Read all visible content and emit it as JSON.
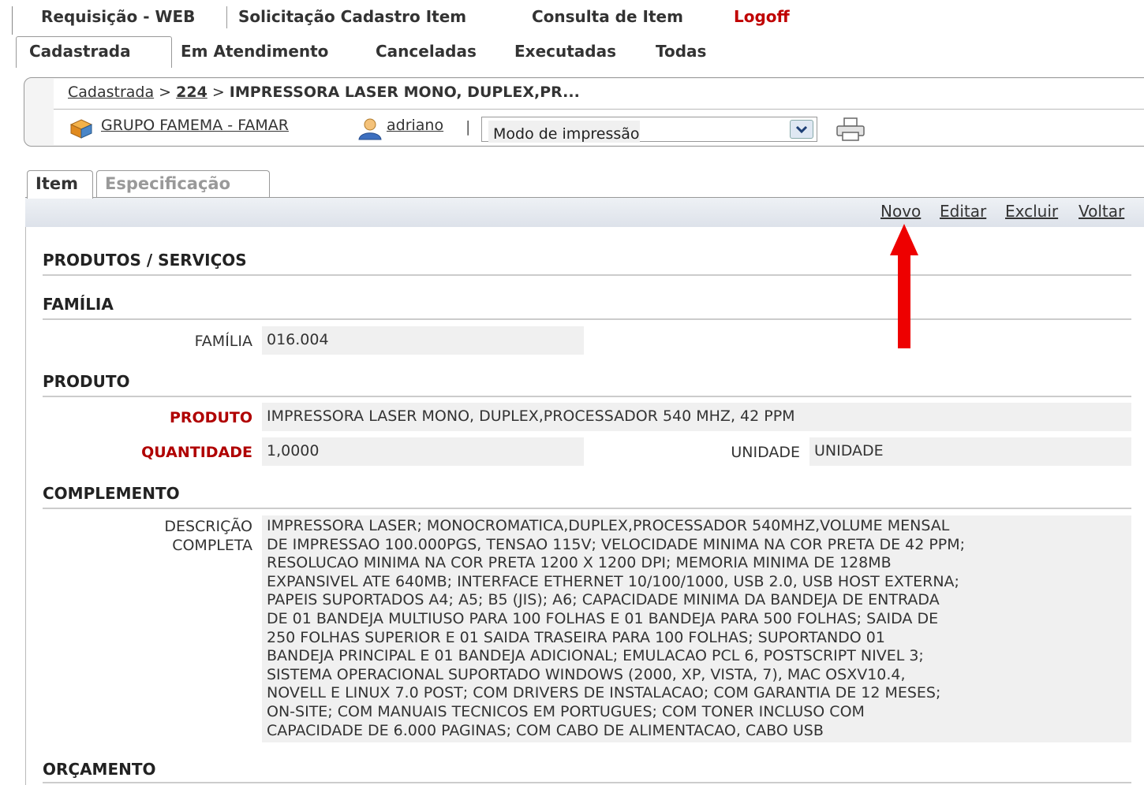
{
  "topnav": {
    "active_tab": "Requisição - WEB",
    "links": [
      "Solicitação Cadastro Item",
      "Consulta de Item",
      "Logoff"
    ]
  },
  "subnav": {
    "active_tab": "Cadastrada",
    "links": [
      "Em Atendimento",
      "Canceladas",
      "Executadas",
      "Todas"
    ]
  },
  "breadcrumb": {
    "link": "Cadastrada",
    "sep1": " > ",
    "number": "224",
    "sep2": " > ",
    "title": "IMPRESSORA LASER MONO, DUPLEX,PR..."
  },
  "infobar": {
    "group_icon": "box-icon",
    "group": "GRUPO FAMEMA - FAMAR",
    "user_icon": "user-icon",
    "user": "adriano",
    "pipe": "|",
    "print_mode": "Modo de impressão",
    "printer_icon": "printer-icon"
  },
  "tabs": {
    "item": "Item",
    "spec": "Especificação"
  },
  "actions": {
    "novo": "Novo",
    "editar": "Editar",
    "excluir": "Excluir",
    "voltar": "Voltar"
  },
  "sections": {
    "produtos": "PRODUTOS / SERVIÇOS",
    "familia": "FAMÍLIA",
    "produto": "PRODUTO",
    "complemento": "COMPLEMENTO",
    "orcamento": "ORÇAMENTO"
  },
  "fields": {
    "familia_label": "FAMÍLIA",
    "familia_value": "016.004",
    "produto_label": "PRODUTO",
    "produto_value": "IMPRESSORA LASER MONO, DUPLEX,PROCESSADOR 540 MHZ, 42 PPM",
    "quantidade_label": "QUANTIDADE",
    "quantidade_value": "1,0000",
    "unidade_label": "UNIDADE",
    "unidade_value": "UNIDADE",
    "descricao_label_1": "DESCRIÇÃO",
    "descricao_label_2": "COMPLETA",
    "descricao_lines": [
      "IMPRESSORA LASER; MONOCROMATICA,DUPLEX,PROCESSADOR 540MHZ,VOLUME MENSAL",
      "DE IMPRESSAO 100.000PGS, TENSAO 115V; VELOCIDADE MINIMA NA COR PRETA DE 42 PPM;",
      "RESOLUCAO MINIMA NA COR PRETA 1200 X 1200 DPI; MEMORIA MINIMA DE 128MB",
      "EXPANSIVEL ATE 640MB; INTERFACE ETHERNET 10/100/1000, USB 2.0, USB HOST EXTERNA;",
      "PAPEIS SUPORTADOS A4; A5; B5 (JIS); A6; CAPACIDADE MINIMA DA BANDEJA DE ENTRADA",
      "DE 01 BANDEJA MULTIUSO PARA 100 FOLHAS E 01 BANDEJA PARA 500 FOLHAS; SAIDA DE",
      "250 FOLHAS SUPERIOR E 01 SAIDA TRASEIRA PARA 100 FOLHAS; SUPORTANDO 01",
      "BANDEJA PRINCIPAL E 01 BANDEJA ADICIONAL; EMULACAO PCL 6, POSTSCRIPT NIVEL 3;",
      "SISTEMA OPERACIONAL SUPORTADO WINDOWS (2000, XP, VISTA, 7), MAC OSXV10.4,",
      "NOVELL E LINUX 7.0 POST; COM DRIVERS DE INSTALACAO; COM GARANTIA DE 12 MESES;",
      "ON-SITE; COM MANUAIS TECNICOS EM PORTUGUES; COM TONER INCLUSO COM",
      "CAPACIDADE DE 6.000 PAGINAS; COM CABO DE ALIMENTACAO, CABO USB"
    ]
  },
  "colors": {
    "required_label": "#b00000",
    "logoff": "#c00000",
    "annotation_arrow": "#ee0000"
  }
}
